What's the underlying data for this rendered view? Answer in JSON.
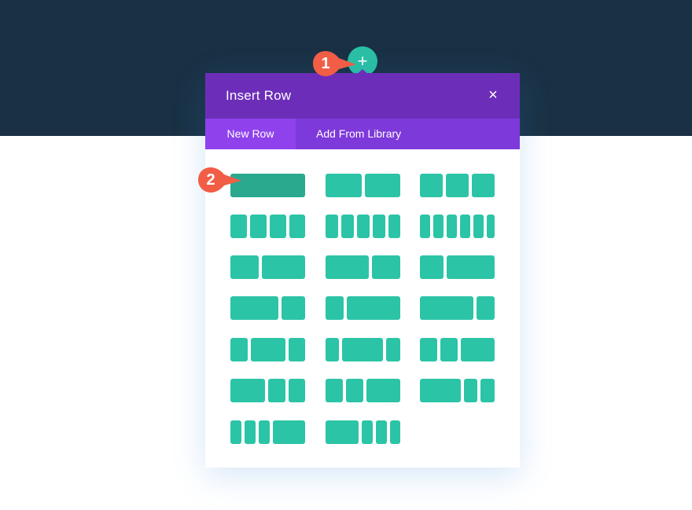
{
  "modal": {
    "title": "Insert Row",
    "close_icon": "×",
    "tabs": [
      {
        "label": "New Row",
        "active": true
      },
      {
        "label": "Add From Library",
        "active": false
      }
    ]
  },
  "add_button": {
    "icon": "+"
  },
  "callouts": [
    {
      "label": "1",
      "target": "add-row-button"
    },
    {
      "label": "2",
      "target": "layout-full-width"
    }
  ],
  "layouts": [
    {
      "name": "1",
      "cols": [
        1
      ],
      "selected": true
    },
    {
      "name": "1/2,1/2",
      "cols": [
        1,
        1
      ]
    },
    {
      "name": "1/3,1/3,1/3",
      "cols": [
        1,
        1,
        1
      ]
    },
    {
      "name": "1/4 x4",
      "cols": [
        1,
        1,
        1,
        1
      ]
    },
    {
      "name": "1/5 x5",
      "cols": [
        1,
        1,
        1,
        1,
        1
      ]
    },
    {
      "name": "1/6 x6",
      "cols": [
        1,
        1,
        1,
        1,
        1,
        1
      ]
    },
    {
      "name": "2/5,3/5",
      "cols": [
        2,
        3
      ]
    },
    {
      "name": "3/5,2/5",
      "cols": [
        3,
        2
      ]
    },
    {
      "name": "1/3,2/3",
      "cols": [
        1,
        2
      ]
    },
    {
      "name": "2/3,1/3",
      "cols": [
        2,
        1
      ]
    },
    {
      "name": "1/4,3/4",
      "cols": [
        1,
        3
      ]
    },
    {
      "name": "3/4,1/4",
      "cols": [
        3,
        1
      ]
    },
    {
      "name": "1/4,1/2,1/4",
      "cols": [
        1,
        2,
        1
      ]
    },
    {
      "name": "1/5,3/5,1/5",
      "cols": [
        1,
        3,
        1
      ]
    },
    {
      "name": "1/4,1/4,1/2",
      "cols": [
        1,
        1,
        2
      ]
    },
    {
      "name": "1/2,1/4,1/4",
      "cols": [
        2,
        1,
        1
      ]
    },
    {
      "name": "1/5,1/5,2/5",
      "cols": [
        1,
        1,
        2
      ]
    },
    {
      "name": "2/5,1/5,1/5",
      "cols": [
        3,
        1,
        1
      ]
    },
    {
      "name": "1/6,1/6,1/6,1/2",
      "cols": [
        1,
        1,
        1,
        3
      ]
    },
    {
      "name": "1/2,1/6,1/6,1/6",
      "cols": [
        3,
        1,
        1,
        1
      ]
    }
  ],
  "colors": {
    "header_bg": "#1a3144",
    "modal_header": "#6c2eb9",
    "tabs_bg": "#7d39d9",
    "tab_active": "#8f42ec",
    "column": "#2bc4a6",
    "callout": "#f25d46"
  }
}
